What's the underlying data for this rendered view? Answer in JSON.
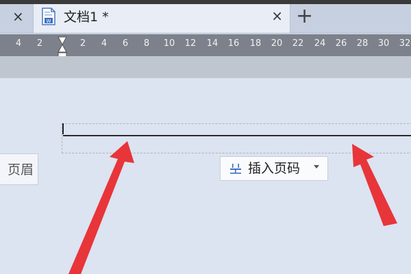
{
  "tabs": {
    "active_title": "文档1 *",
    "close_symbol": "×",
    "new_tab_symbol": "+"
  },
  "ruler": {
    "labels": [
      "4",
      "2",
      "2",
      "4",
      "6",
      "8",
      "10",
      "12",
      "14",
      "16",
      "18",
      "20",
      "22",
      "24",
      "26",
      "28",
      "30",
      "32"
    ]
  },
  "header": {
    "page_header_label": "页眉"
  },
  "insert_page_number": {
    "label": "插入页码"
  },
  "colors": {
    "annotation_arrow": "#e8353a",
    "ruler_bg": "#7c818b",
    "workspace_bg": "#dce3f1"
  }
}
